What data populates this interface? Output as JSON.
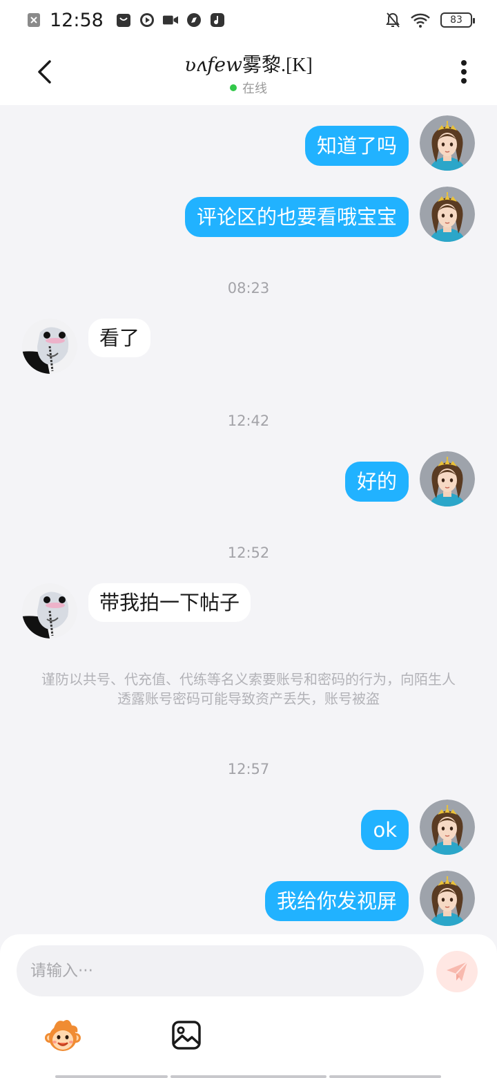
{
  "status_bar": {
    "time": "12:58",
    "battery": "83",
    "left_icons": [
      "close-box-icon",
      "bag-icon",
      "play-icon",
      "video-icon",
      "compass-icon",
      "music-icon"
    ],
    "right_icons": [
      "mute-bell-icon",
      "wifi-icon",
      "battery-icon"
    ]
  },
  "header": {
    "title_script": "ʋʌfew",
    "title_text": "雾黎.[K]",
    "status": "在线",
    "status_color": "#32c84a"
  },
  "messages": [
    {
      "from": "me",
      "text": "知道了吗"
    },
    {
      "from": "me",
      "text": "评论区的也要看哦宝宝"
    },
    {
      "type": "timestamp",
      "text": "08:23"
    },
    {
      "from": "other",
      "text": "看了"
    },
    {
      "type": "timestamp",
      "text": "12:42"
    },
    {
      "from": "me",
      "text": "好的"
    },
    {
      "type": "timestamp",
      "text": "12:52"
    },
    {
      "from": "other",
      "text": "带我拍一下帖子"
    },
    {
      "type": "notice",
      "text": "谨防以共号、代充值、代练等名义索要账号和密码的行为，向陌生人透露账号密码可能导致资产丢失，账号被盗"
    },
    {
      "type": "timestamp",
      "text": "12:57"
    },
    {
      "from": "me",
      "text": "ok"
    },
    {
      "from": "me",
      "text": "我给你发视屏"
    }
  ],
  "input": {
    "placeholder": "请输入···"
  },
  "colors": {
    "my_bubble": "#21b2ff",
    "other_bubble": "#ffffff",
    "background": "#f4f4f7"
  }
}
